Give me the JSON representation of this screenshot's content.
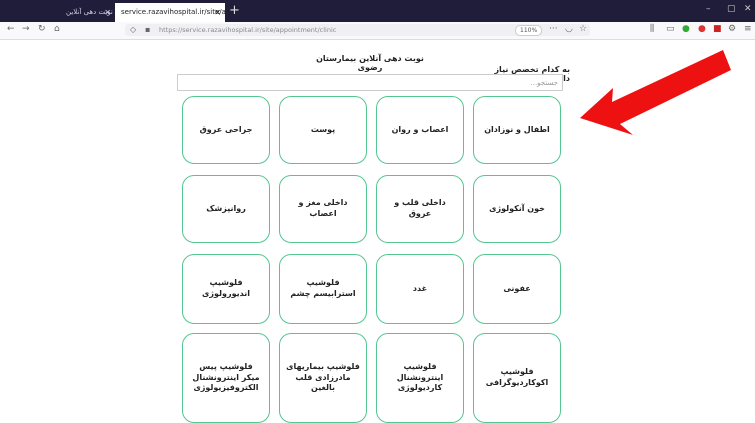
{
  "browser": {
    "tabs": [
      {
        "label": "نوبت دهی آنلاین"
      },
      {
        "label": "service.razavihospital.ir/site/appoi"
      }
    ],
    "new_tab": "+",
    "close": "✕",
    "url": "https://service.razavihospital.ir/site/appointment/clinic",
    "zoom": "110%",
    "window_controls": [
      "–",
      "▢",
      "✕"
    ]
  },
  "page": {
    "title": "نوبت دهی آنلاین بیمارستان رضوی",
    "question": "به کدام تخصص نیاز دارید؟",
    "search_placeholder": "جستجو..."
  },
  "clinics": [
    "اطفال و نوزادان",
    "اعصاب و روان",
    "پوست",
    "جراحی عروق",
    "خون آنکولوژی",
    "داخلی قلب و عروق",
    "داخلی مغز و اعصاب",
    "روانپزشک",
    "عفونی",
    "غدد",
    "فلوشیپ استرابیسم چشم",
    "فلوشیپ اندیورولوژی",
    "فلوشیپ اکوکاردیوگرافی",
    "فلوشیپ اینترونشنال کاردیولوژی",
    "فلوشیپ بیماریهای مادرزادی قلب بالغین",
    "فلوشیپ پیس میکر اینترونشنال الکتروفیزیولوژی"
  ],
  "colors": {
    "card_border": "#55c690",
    "annotation_arrow": "#ee1111",
    "tab_bar": "#1f1d3a"
  },
  "annotation": {
    "arrow_icon": "arrow-pointing-left-icon"
  }
}
